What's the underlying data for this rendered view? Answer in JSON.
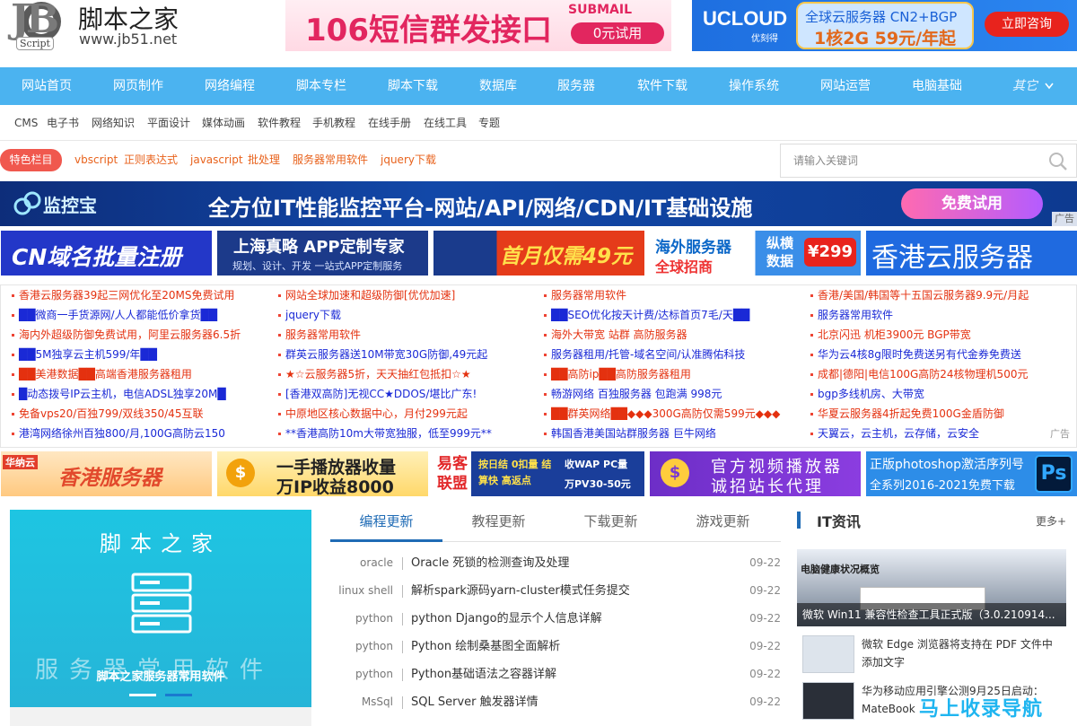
{
  "header": {
    "logo_letters": "JB",
    "logo_script": "Script",
    "site_name": "脚本之家",
    "site_url": "www.jb51.net",
    "ad_sms": {
      "headline": "106短信群发接口",
      "brand": "SUBMAIL",
      "button": "0元试用"
    },
    "ad_ucloud": {
      "brand": "UCLOUD",
      "brand_sub": "优刻得",
      "line1": "全球云服务器 CN2+BGP",
      "line2": "1核2G 59元/年起",
      "button": "立即咨询"
    }
  },
  "nav": {
    "items": [
      "网站首页",
      "网页制作",
      "网络编程",
      "脚本专栏",
      "脚本下载",
      "数据库",
      "服务器",
      "软件下载",
      "操作系统",
      "网站运营",
      "电脑基础"
    ],
    "more": "其它"
  },
  "subnav": [
    "CMS",
    "电子书",
    "网络知识",
    "平面设计",
    "媒体动画",
    "软件教程",
    "手机教程",
    "在线手册",
    "在线工具",
    "专题"
  ],
  "special": {
    "tag": "特色栏目",
    "links": [
      "vbscript",
      "正则表达式",
      "javascript",
      "批处理",
      "服务器常用软件",
      "jquery下载"
    ]
  },
  "search": {
    "placeholder": "请输入关键词",
    "icon": "search-icon"
  },
  "monitor_banner": {
    "brand": "监控宝",
    "headline": "全方位IT性能监控平台-网站/API/网络/CDN/IT基础设施",
    "button": "免费试用",
    "ad_label": "广告"
  },
  "tiles_row1": [
    {
      "text": "CN域名批量注册"
    },
    {
      "text": "上海真略 APP定制专家",
      "sub": "规划、设计、开发 一站式APP定制服务"
    },
    {
      "text": "首月仅需49元"
    },
    {
      "text": "海外服务器",
      "sub": "全球招商",
      "extra": "纵横数据",
      "price": "¥299"
    },
    {
      "text": "香港云服务器"
    }
  ],
  "text_ads": [
    [
      "香港云服务器39起三网优化至20MS免费试用",
      "██微商一手货源网/人人都能低价拿货██",
      "海内外超级防御免费试用，阿里云服务器6.5折",
      "██5M独享云主机599/年██",
      "██美港数据██高端香港服务器租用",
      "█动态拨号IP云主机，电信ADSL独享20M█",
      "免备vps20/百独799/双线350/45互联",
      "港湾网络徐州百独800/月,100G高防云150"
    ],
    [
      "网站全球加速和超级防御[优优加速]",
      "jquery下载",
      "服务器常用软件",
      "群英云服务器送10M带宽30G防御,49元起",
      "★☆云服务器5折，天天抽红包抵扣☆★",
      "[香港双高防]无视CC★DDOS/堪比广东!",
      "中原地区核心数据中心，月付299元起",
      "**香港高防10m大带宽独服，低至999元**"
    ],
    [
      "服务器常用软件",
      "██SEO优化按天计费/达标首页7毛/天██",
      "海外大带宽 站群 高防服务器",
      "服务器租用/托管-域名空间/认准腾佑科技",
      "██高防ip██高防服务器租用",
      "畅游网络 百独服务器 包跑满 998元",
      "██群英网络██◆◆◆300G高防仅需599元◆◆◆",
      "韩国香港美国站群服务器 巨牛网络"
    ],
    [
      "香港/美国/韩国等十五国云服务器9.9元/月起",
      "服务器常用软件",
      "北京闪迅 机柜3900元 BGP带宽",
      "华为云4核8g限时免费送另有代金券免费送",
      "成都|德阳|电信100G高防24核物理机500元",
      "bgp多线机房、大带宽",
      "华夏云服务器4折起免费100G金盾防御",
      "天翼云，云主机，云存储，云安全"
    ]
  ],
  "text_ads_label": "广告",
  "tiles_row2": [
    {
      "brand": "华纳云",
      "text": "香港服务器"
    },
    {
      "text": "一手播放器收量",
      "sub": "万IP收益8000"
    },
    {
      "text": "易客联盟",
      "sub": "按日结 0扣量 结算快 高返点",
      "extra": "收WAP PC量",
      "extra2": "万PV30-50元"
    },
    {
      "text": "官方视频播放器",
      "sub": "诚招站长代理"
    },
    {
      "text": "正版photoshop激活序列号",
      "sub": "全系列2016-2021免费下载",
      "badge": "Ps"
    }
  ],
  "feature": {
    "title": "脚本之家",
    "bg_text": "服务器常用软件",
    "caption": "脚本之家服务器常用软件"
  },
  "tabs": [
    "编程更新",
    "教程更新",
    "下载更新",
    "游戏更新"
  ],
  "articles": [
    {
      "cat": "oracle",
      "title": "Oracle 死锁的检测查询及处理",
      "date": "09-22"
    },
    {
      "cat": "linux shell",
      "title": "解析spark源码yarn-cluster模式任务提交",
      "date": "09-22"
    },
    {
      "cat": "python",
      "title": "python Django的显示个人信息详解",
      "date": "09-22"
    },
    {
      "cat": "python",
      "title": "Python 绘制桑基图全面解析",
      "date": "09-22"
    },
    {
      "cat": "python",
      "title": "Python基础语法之容器详解",
      "date": "09-22"
    },
    {
      "cat": "MsSql",
      "title": "SQL Server 触发器详情",
      "date": "09-22"
    }
  ],
  "it_news": {
    "title": "IT资讯",
    "more": "更多+",
    "image_title": "电脑健康状况概览",
    "image_caption": "微软 Win11 兼容性检查工具正式版（3.0.210914...",
    "items": [
      {
        "text": "微软 Edge 浏览器将支持在 PDF 文件中添加文字"
      },
      {
        "text": "华为移动应用引擎公测9月25日启动：MateBook"
      }
    ]
  },
  "watermark": "马上收录导航"
}
